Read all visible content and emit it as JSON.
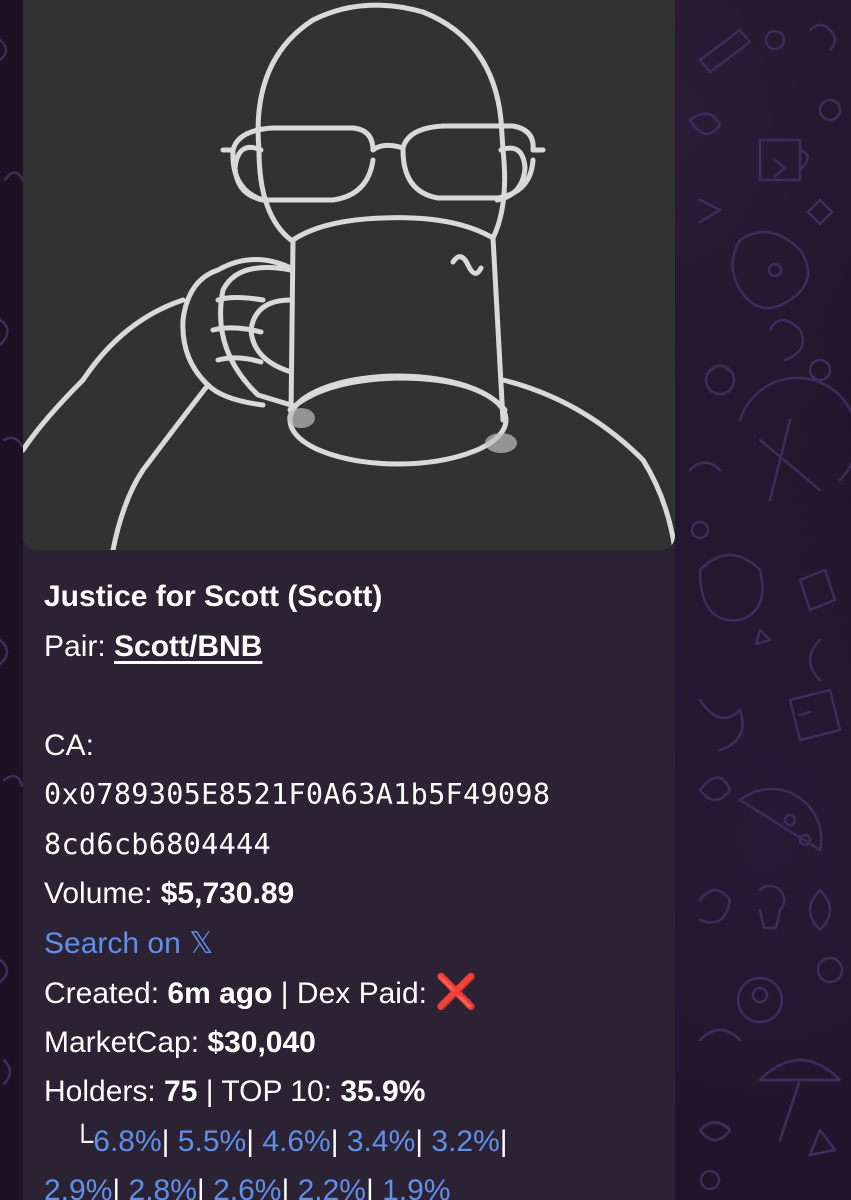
{
  "message": {
    "title": "Justice for Scott (Scott)",
    "pair_label": "Pair: ",
    "pair_value": "Scott/BNB",
    "ca_label": "CA:",
    "ca_line1": "0x0789305E8521F0A63A1b5F49098",
    "ca_line2": "8cd6cb6804444",
    "volume_label": "Volume: ",
    "volume_value": "$5,730.89",
    "search_link": "Search on 𝕏",
    "created_label": "Created: ",
    "created_value": "6m ago",
    "dex_paid_label": " | Dex Paid: ",
    "dex_paid_icon": "cross-mark-icon",
    "dex_paid_value": "❌",
    "marketcap_label": "MarketCap: ",
    "marketcap_value": "$30,040",
    "holders_label": "Holders: ",
    "holders_value": "75",
    "top10_label": " | TOP 10: ",
    "top10_value": "35.9%",
    "branch_glyph": "└",
    "top_holders": [
      "6.8%",
      "5.5%",
      "4.6%",
      "3.4%",
      "3.2%",
      "2.9%",
      "2.8%",
      "2.6%",
      "2.2%",
      "1.9%"
    ],
    "separator": "| "
  },
  "colors": {
    "bubble": "#2b2233",
    "link_blue": "#5f8fe8",
    "cross_red": "#e0312a",
    "chat_bg": "#1b1324"
  }
}
